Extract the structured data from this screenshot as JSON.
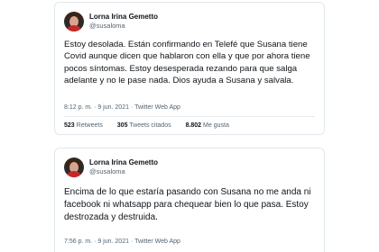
{
  "tweets": [
    {
      "name": "Lorna Irina Gemetto",
      "handle": "@susaloma",
      "text": "Estoy desolada. Están confirmando en Telefé que Susana tiene Covid aunque dicen que hablaron con ella y que por ahora tiene pocos síntomas. Estoy desesperada rezando para que salga adelante y no le pase nada. Dios ayuda a Susana y salvala.",
      "time": "8:12 p. m. · 9 jun. 2021 · Twitter Web App",
      "stats": {
        "retweets": "523",
        "retweets_label": "Retweets",
        "quotes": "305",
        "quotes_label": "Tweets citados",
        "likes": "8.802",
        "likes_label": "Me gusta"
      }
    },
    {
      "name": "Lorna Irina Gemetto",
      "handle": "@susaloma",
      "text": "Encima de lo que estaría pasando con Susana no me anda ni facebook ni whatsapp para chequear bien lo que pasa. Estoy destrozada y destruida.",
      "time": "7:56 p. m. · 9 jun. 2021 · Twitter Web App"
    }
  ],
  "colors": {
    "border": "#e1e8ed",
    "text": "#0f1419",
    "secondary": "#536471"
  }
}
